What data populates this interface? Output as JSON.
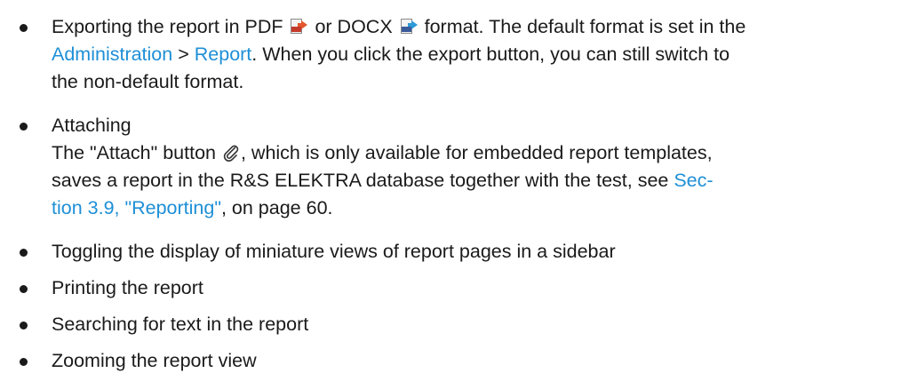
{
  "items": [
    {
      "seg1": "Exporting the report in PDF ",
      "pdf_icon": "pdf-export-icon",
      "seg2": " or DOCX ",
      "docx_icon": "docx-export-icon",
      "seg3": " format. The default format is set in the",
      "link1": "Administration",
      "seg4": " > ",
      "link2": "Report",
      "seg5": ". When you click the export button, you can still switch to",
      "seg6": "the non-default format."
    },
    {
      "title": "Attaching",
      "seg1": "The \"Attach\" button ",
      "attach_icon": "paperclip-icon",
      "seg2": ", which is only available for embedded report templates,",
      "seg3": "saves a report in the R&S ELEKTRA database together with the test, see ",
      "link1": "Sec-",
      "link2": "tion 3.9, \"Reporting\"",
      "seg4": ", on page 60."
    },
    {
      "text": "Toggling the display of miniature views of report pages in a sidebar"
    },
    {
      "text": "Printing the report"
    },
    {
      "text": "Searching for text in the report"
    },
    {
      "text": "Zooming the report view"
    }
  ],
  "colors": {
    "link": "#1e8fd6",
    "text": "#1a1a1a"
  }
}
